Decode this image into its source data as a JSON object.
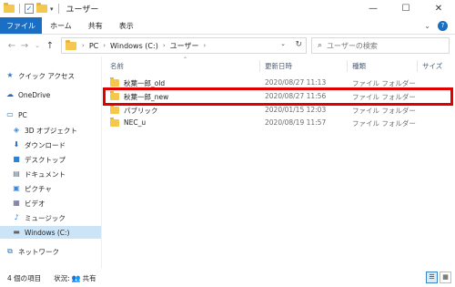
{
  "window": {
    "title": "ユーザー",
    "minimize": "—",
    "maximize": "☐",
    "close": "✕"
  },
  "ribbon": {
    "tabs": [
      "ファイル",
      "ホーム",
      "共有",
      "表示"
    ],
    "expand": "⌄",
    "help": "?"
  },
  "nav": {
    "back": "←",
    "forward": "→",
    "recent": "⌄",
    "up": "↑",
    "address": [
      "PC",
      "Windows (C:)",
      "ユーザー"
    ],
    "refresh": "↻",
    "search_placeholder": "ユーザーの検索"
  },
  "sidebar": {
    "items": [
      {
        "label": "クイック アクセス",
        "icon": "star-icon"
      },
      {
        "label": "OneDrive",
        "icon": "cloud-icon"
      },
      {
        "label": "PC",
        "icon": "computer-icon"
      },
      {
        "label": "3D オブジェクト",
        "icon": "cube-icon"
      },
      {
        "label": "ダウンロード",
        "icon": "download-icon"
      },
      {
        "label": "デスクトップ",
        "icon": "desktop-icon"
      },
      {
        "label": "ドキュメント",
        "icon": "document-icon"
      },
      {
        "label": "ピクチャ",
        "icon": "picture-icon"
      },
      {
        "label": "ビデオ",
        "icon": "video-icon"
      },
      {
        "label": "ミュージック",
        "icon": "music-icon"
      },
      {
        "label": "Windows (C:)",
        "icon": "drive-icon"
      },
      {
        "label": "ネットワーク",
        "icon": "network-icon"
      }
    ],
    "selected": "Windows (C:)"
  },
  "table": {
    "columns": [
      "名前",
      "更新日時",
      "種類",
      "サイズ"
    ],
    "rows": [
      {
        "name": "秋葉一郎_old",
        "modified": "2020/08/27 11:13",
        "type": "ファイル フォルダー"
      },
      {
        "name": "秋葉一郎_new",
        "modified": "2020/08/27 11:56",
        "type": "ファイル フォルダー"
      },
      {
        "name": "パブリック",
        "modified": "2020/01/15 12:03",
        "type": "ファイル フォルダー"
      },
      {
        "name": "NEC_u",
        "modified": "2020/08/19 11:57",
        "type": "ファイル フォルダー"
      }
    ],
    "highlighted_row": "秋葉一郎_new"
  },
  "status": {
    "count": "4 個の項目",
    "state_label": "状況:",
    "state_value": "共有"
  },
  "colors": {
    "accent": "#1a6fc4",
    "highlight_border": "#e00000",
    "folder": "#f4c74f",
    "selected_bg": "#cce4f7"
  }
}
